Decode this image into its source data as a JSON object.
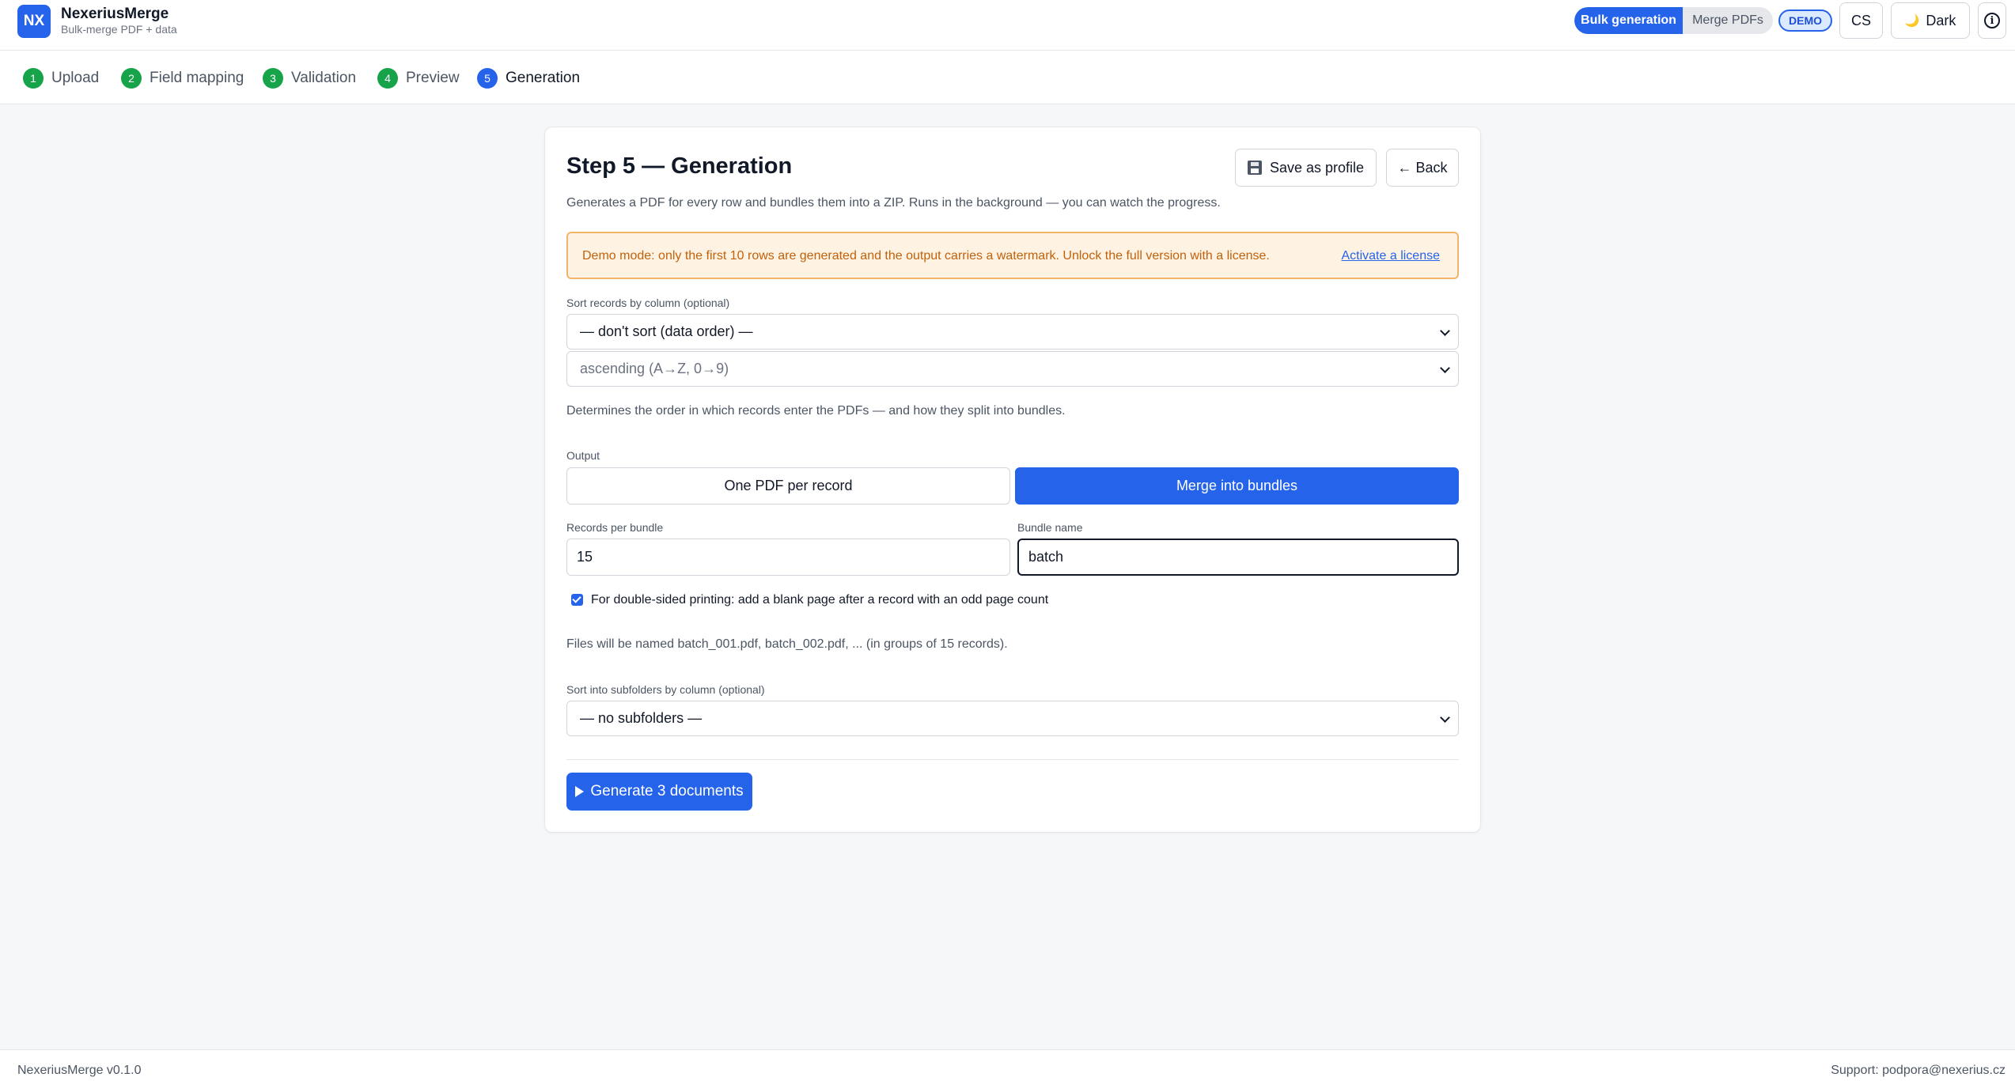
{
  "header": {
    "logo_text": "NX",
    "app_name": "NexeriusMerge",
    "app_subtitle": "Bulk-merge PDF + data",
    "modes": [
      "Bulk generation",
      "Merge PDFs"
    ],
    "demo_badge": "DEMO",
    "language": "CS",
    "theme_icon": "🌙",
    "theme_label": "Dark",
    "info_icon": "i"
  },
  "steps": [
    {
      "num": "1",
      "label": "Upload"
    },
    {
      "num": "2",
      "label": "Field mapping"
    },
    {
      "num": "3",
      "label": "Validation"
    },
    {
      "num": "4",
      "label": "Preview"
    },
    {
      "num": "5",
      "label": "Generation"
    }
  ],
  "card": {
    "title": "Step 5 — Generation",
    "save_profile": "Save as profile",
    "back": "← Back",
    "description": "Generates a PDF for every row and bundles them into a ZIP. Runs in the background — you can watch the progress.",
    "demo_alert": "Demo mode: only the first 10 rows are generated and the output carries a watermark. Unlock the full version with a license.",
    "activate_link": "Activate a license",
    "sort_label": "Sort records by column (optional)",
    "sort_value": "— don't sort (data order) —",
    "order_value": "ascending (A→Z, 0→9)",
    "sort_hint": "Determines the order in which records enter the PDFs — and how they split into bundles.",
    "output_label": "Output",
    "output_options": [
      "One PDF per record",
      "Merge into bundles"
    ],
    "records_label": "Records per bundle",
    "records_value": "15",
    "bundle_label": "Bundle name",
    "bundle_value": "batch",
    "duplex_label": "For double-sided printing: add a blank page after a record with an odd page count",
    "files_hint": "Files will be named batch_001.pdf, batch_002.pdf, ... (in groups of 15 records).",
    "subfolder_label": "Sort into subfolders by column (optional)",
    "subfolder_value": "— no subfolders —",
    "generate": "Generate 3 documents"
  },
  "footer": {
    "version": "NexeriusMerge v0.1.0",
    "support": "Support: podpora@nexerius.cz"
  },
  "colors": {
    "accent": "#2563eb",
    "success": "#16a34a",
    "warning_bg": "#fef3e2",
    "warning_text": "#c2610c"
  }
}
